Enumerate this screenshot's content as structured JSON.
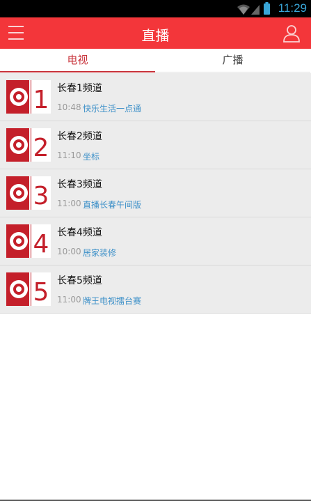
{
  "status_bar": {
    "time": "11:29"
  },
  "header": {
    "title": "直播"
  },
  "tabs": [
    {
      "label": "电视",
      "active": true
    },
    {
      "label": "广播",
      "active": false
    }
  ],
  "channels": [
    {
      "number": "1",
      "name": "长春1频道",
      "time": "10:48",
      "program": "快乐生活一点通"
    },
    {
      "number": "2",
      "name": "长春2频道",
      "time": "11:10",
      "program": "坐标"
    },
    {
      "number": "3",
      "name": "长春3频道",
      "time": "11:00",
      "program": "直播长春午间版"
    },
    {
      "number": "4",
      "name": "长春4频道",
      "time": "10:00",
      "program": "居家装修"
    },
    {
      "number": "5",
      "name": "长春5频道",
      "time": "11:00",
      "program": "牌王电视擂台赛"
    }
  ],
  "colors": {
    "accent": "#f3363a",
    "tab_active": "#c8323a",
    "program_link": "#3b8fc8",
    "logo_red": "#c41f2a"
  },
  "icons": [
    "wifi-icon",
    "signal-icon",
    "battery-icon",
    "menu-icon",
    "user-icon"
  ]
}
